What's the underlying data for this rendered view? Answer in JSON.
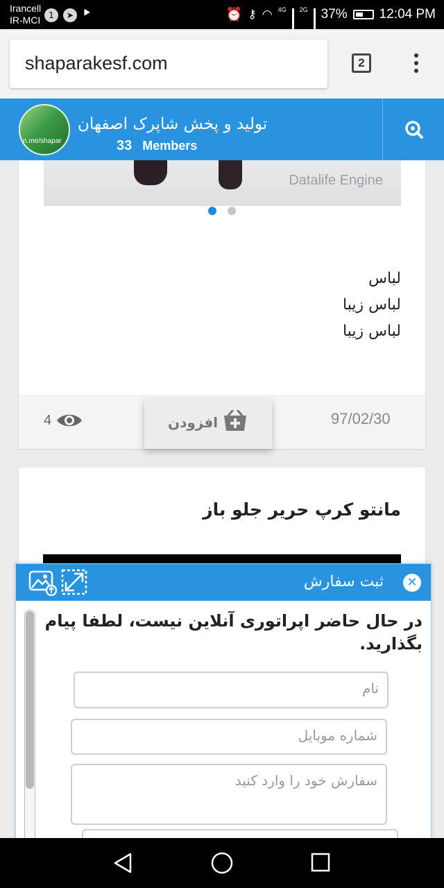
{
  "status": {
    "carrier1": "Irancell",
    "carrier2": "IR-MCI",
    "notif_count": "1",
    "network1": "4G",
    "network2": "2G",
    "battery": "37%",
    "time": "12:04 PM"
  },
  "browser": {
    "url": "shaparakesf.com",
    "tab_count": "2"
  },
  "channel": {
    "title": "تولید و پخش شاپرک اصفهان",
    "members_count": "33",
    "members_label": "Members",
    "avatar_text": "n.me/shapar"
  },
  "post1": {
    "image_watermark": "Datalife Engine",
    "lines": [
      "لباس",
      "لباس زیبا",
      "لباس زیبا"
    ],
    "views": "4",
    "date": "97/02/30",
    "add_label": "افزودن"
  },
  "post2": {
    "title": "مانتو کرپ حریر جلو باز"
  },
  "chat": {
    "title": "ثبت سفارش",
    "message": "در حال حاضر اپراتوری آنلاین نیست، لطفا پیام بگذارید.",
    "name_placeholder": "نام",
    "mobile_placeholder": "شماره موبایل",
    "order_placeholder": "سفارش خود را وارد کنید"
  },
  "colors": {
    "brand_blue": "#2a93e0",
    "dot_active": "#1f88e5"
  }
}
